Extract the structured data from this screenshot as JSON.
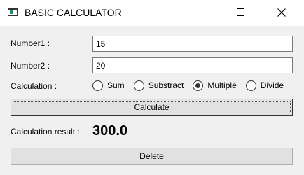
{
  "window": {
    "title": "BASIC CALCULATOR",
    "controls": {
      "minimize_icon": "minimize-icon",
      "maximize_icon": "maximize-icon",
      "close_icon": "close-icon"
    }
  },
  "form": {
    "number1": {
      "label": "Number1 :",
      "value": "15"
    },
    "number2": {
      "label": "Number2 :",
      "value": "20"
    },
    "calculation": {
      "label": "Calculation :",
      "options": [
        {
          "label": "Sum",
          "selected": false
        },
        {
          "label": "Substract",
          "selected": false
        },
        {
          "label": "Multiple",
          "selected": true
        },
        {
          "label": "Divide",
          "selected": false
        }
      ]
    },
    "calculate_button": "Calculate",
    "result": {
      "label": "Calculation result :",
      "value": "300.0"
    },
    "delete_button": "Delete"
  },
  "colors": {
    "window_background": "#f0f0f0",
    "titlebar_background": "#ffffff",
    "button_background": "#e1e1e1",
    "icon_accent": "#1a8f78"
  }
}
